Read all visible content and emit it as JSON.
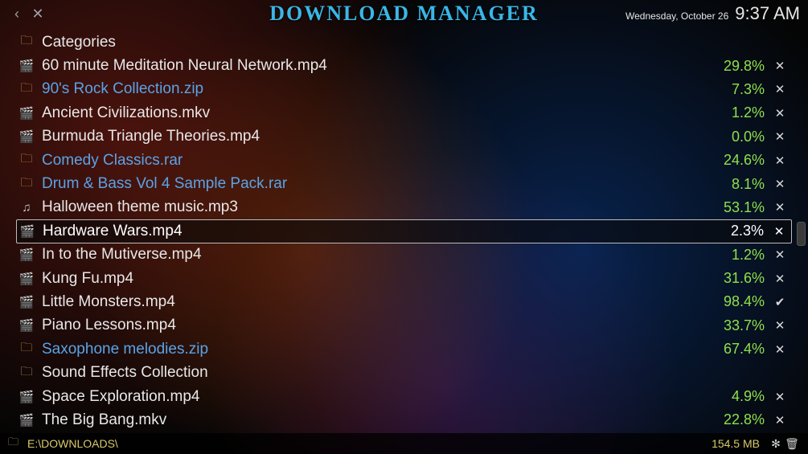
{
  "header": {
    "title": "DOWNLOAD MANAGER",
    "date": "Wednesday, October 26",
    "time": "9:37 AM"
  },
  "categories_label": "Categories",
  "items": [
    {
      "name": "60 minute Meditation Neural Network.mp4",
      "icon": "video",
      "link": false,
      "percent": "29.8%",
      "action": "cancel"
    },
    {
      "name": "90's Rock Collection.zip",
      "icon": "archive",
      "link": true,
      "percent": "7.3%",
      "action": "cancel"
    },
    {
      "name": "Ancient Civilizations.mkv",
      "icon": "video",
      "link": false,
      "percent": "1.2%",
      "action": "cancel"
    },
    {
      "name": "Burmuda Triangle Theories.mp4",
      "icon": "video",
      "link": false,
      "percent": "0.0%",
      "action": "cancel"
    },
    {
      "name": "Comedy Classics.rar",
      "icon": "archive",
      "link": true,
      "percent": "24.6%",
      "action": "cancel"
    },
    {
      "name": "Drum & Bass Vol 4 Sample Pack.rar",
      "icon": "archive",
      "link": true,
      "percent": "8.1%",
      "action": "cancel"
    },
    {
      "name": "Halloween theme music.mp3",
      "icon": "audio",
      "link": false,
      "percent": "53.1%",
      "action": "cancel"
    },
    {
      "name": "Hardware Wars.mp4",
      "icon": "video",
      "link": false,
      "percent": "2.3%",
      "action": "cancel",
      "selected": true
    },
    {
      "name": "In to the Mutiverse.mp4",
      "icon": "video",
      "link": false,
      "percent": "1.2%",
      "action": "cancel"
    },
    {
      "name": "Kung Fu.mp4",
      "icon": "video",
      "link": false,
      "percent": "31.6%",
      "action": "cancel"
    },
    {
      "name": "Little Monsters.mp4",
      "icon": "video",
      "link": false,
      "percent": "98.4%",
      "action": "done"
    },
    {
      "name": "Piano Lessons.mp4",
      "icon": "video",
      "link": false,
      "percent": "33.7%",
      "action": "cancel"
    },
    {
      "name": "Saxophone melodies.zip",
      "icon": "archive",
      "link": true,
      "percent": "67.4%",
      "action": "cancel"
    },
    {
      "name": "Sound Effects Collection",
      "icon": "folder",
      "link": false,
      "percent": "",
      "action": ""
    },
    {
      "name": "Space Exploration.mp4",
      "icon": "video",
      "link": false,
      "percent": "4.9%",
      "action": "cancel"
    },
    {
      "name": "The Big Bang.mkv",
      "icon": "video",
      "link": false,
      "percent": "22.8%",
      "action": "cancel"
    }
  ],
  "footer": {
    "path": "E:\\DOWNLOADS\\",
    "size": "154.5 MB"
  },
  "glyphs": {
    "back": "‹",
    "close": "✕",
    "cancel": "✕",
    "done": "✔",
    "gear": "✻",
    "trash": "🗑",
    "folder": "🗀",
    "video": "🎬",
    "archive": "🗀",
    "audio": "♫"
  }
}
